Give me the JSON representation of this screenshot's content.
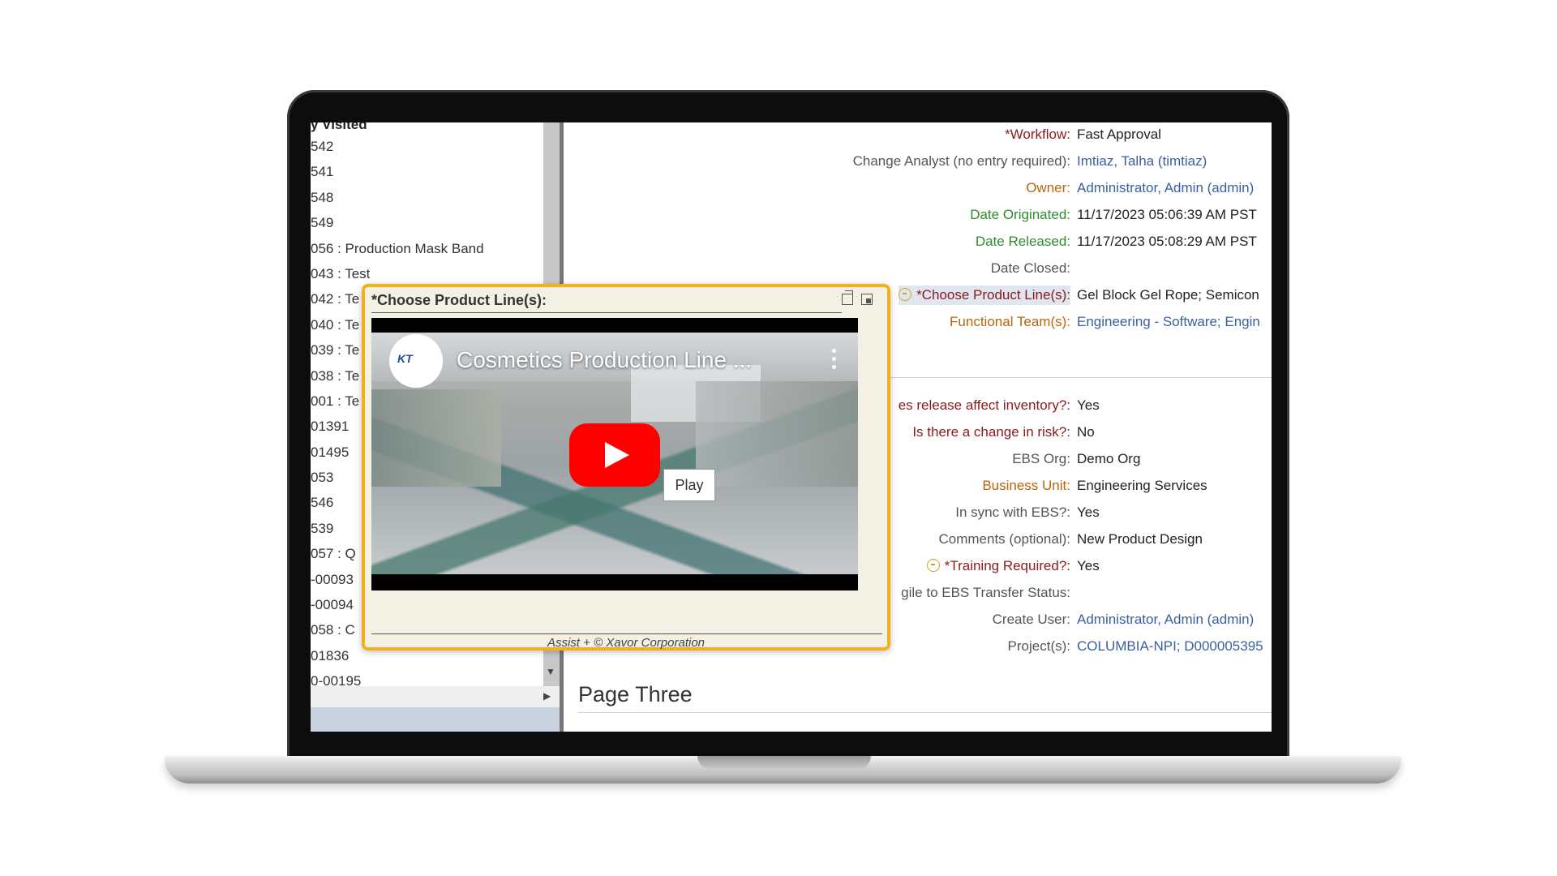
{
  "left_panel": {
    "heading": "y Visited",
    "items": [
      "542",
      "541",
      "548",
      "549",
      "056 : Production Mask Band",
      "043 : Test",
      "042 : Te",
      "040 : Te",
      "039 : Te",
      "038 : Te",
      "001 : Te",
      "01391",
      "01495",
      "053",
      "546",
      "539",
      "057 : Q",
      "-00093",
      "-00094",
      "058 : C",
      "01836",
      "0-00195"
    ]
  },
  "form": {
    "fields": [
      {
        "label": "*Workflow:",
        "value": "Fast Approval"
      },
      {
        "label": "Change Analyst (no entry required):",
        "value": "Imtiaz, Talha (timtiaz)"
      },
      {
        "label": "Owner:",
        "value": "Administrator, Admin (admin)"
      },
      {
        "label": "Date Originated:",
        "value": "11/17/2023 05:06:39 AM PST"
      },
      {
        "label": "Date Released:",
        "value": "11/17/2023 05:08:29 AM PST"
      },
      {
        "label": "Date Closed:",
        "value": ""
      },
      {
        "label": "*Choose Product Line(s):",
        "value": "Gel Block Gel Rope; Semicon"
      },
      {
        "label": "Functional Team(s):",
        "value": "Engineering - Software; Engin"
      }
    ],
    "fields2": [
      {
        "label": "es release affect inventory?:",
        "value": "Yes"
      },
      {
        "label": "Is there a change in risk?:",
        "value": "No"
      },
      {
        "label": "EBS Org:",
        "value": "Demo Org"
      },
      {
        "label": "Business Unit:",
        "value": "Engineering Services"
      },
      {
        "label": "In sync with EBS?:",
        "value": "Yes"
      },
      {
        "label": "Comments (optional):",
        "value": "New Product Design"
      },
      {
        "label": "*Training Required?:",
        "value": "Yes"
      },
      {
        "label": "gile to EBS Transfer Status:",
        "value": ""
      },
      {
        "label": "Create User:",
        "value": "Administrator, Admin (admin)"
      },
      {
        "label": "Project(s):",
        "value": "COLUMBIA-NPI; D000005395"
      }
    ],
    "section_title": "Page Three"
  },
  "popup": {
    "title": "*Choose Product Line(s):",
    "video_title": "Cosmetics Production Line ...",
    "play_tooltip": "Play",
    "footer": "Assist + © Xavor Corporation"
  },
  "colors": {
    "popup_border": "#f2b01e",
    "label_red": "#8b1a1a",
    "label_green": "#2e8b2e",
    "label_orange": "#b8650b",
    "link_blue": "#3a5f9e",
    "youtube_red": "#ff0000"
  }
}
